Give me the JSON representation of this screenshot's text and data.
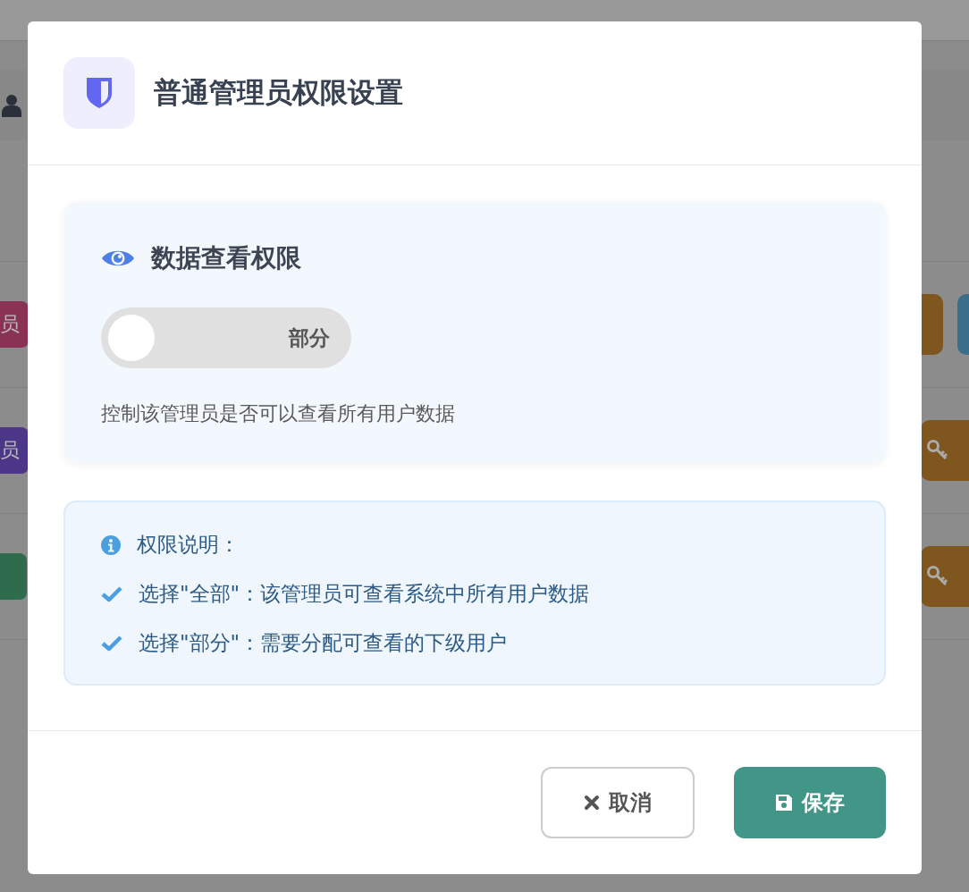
{
  "background": {
    "rows": [
      {
        "kind": "header"
      },
      {
        "kind": "user"
      },
      {
        "kind": "spacer"
      },
      {
        "kind": "entry",
        "badge": {
          "label": "员",
          "color": "#8a3253"
        },
        "actions": [
          {
            "kind": "plain",
            "color": "#80561f"
          },
          {
            "kind": "plain",
            "color": "#3a6f8c"
          }
        ]
      },
      {
        "kind": "entry",
        "badge": {
          "label": "员",
          "color": "#4b3688"
        },
        "actions": [
          {
            "kind": "key",
            "color": "#80561f"
          }
        ]
      },
      {
        "kind": "entry",
        "badge": {
          "color": "#2f6c4d"
        },
        "actions": [
          {
            "kind": "key",
            "color": "#80561f"
          }
        ]
      },
      {
        "kind": "spacer"
      }
    ]
  },
  "dialog": {
    "title": "普通管理员权限设置",
    "permission": {
      "title": "数据查看权限",
      "toggle": {
        "label": "部分",
        "on": false
      },
      "description": "控制该管理员是否可以查看所有用户数据"
    },
    "info": {
      "title": "权限说明：",
      "items": [
        "选择\"全部\"：该管理员可查看系统中所有用户数据",
        "选择\"部分\"：需要分配可查看的下级用户"
      ]
    },
    "buttons": [
      {
        "kind": "cancel",
        "label": "取消"
      },
      {
        "kind": "save",
        "label": "保存"
      }
    ]
  }
}
